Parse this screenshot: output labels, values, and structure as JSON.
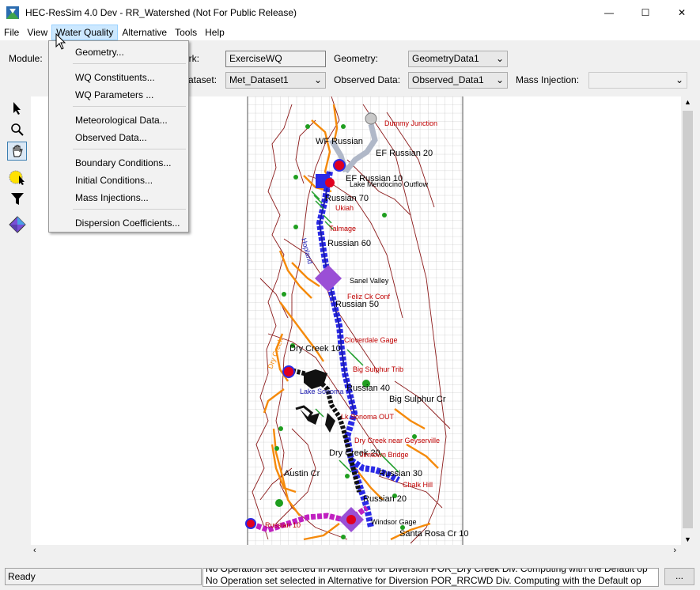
{
  "window": {
    "title": "HEC-ResSim 4.0 Dev  - RR_Watershed (Not For Public Release)",
    "minimize": "—",
    "maximize": "☐",
    "close": "✕"
  },
  "menu": {
    "items": [
      "File",
      "View",
      "Water Quality",
      "Alternative",
      "Tools",
      "Help"
    ],
    "active": "Water Quality"
  },
  "dropdown": {
    "groups": [
      [
        "Geometry..."
      ],
      [
        "WQ Constituents...",
        "WQ Parameters ..."
      ],
      [
        "Meteorological Data...",
        "Observed Data..."
      ],
      [
        "Boundary Conditions...",
        "Initial Conditions...",
        "Mass Injections..."
      ],
      [
        "Dispersion Coefficients..."
      ]
    ]
  },
  "fields": {
    "module_label": "Module:",
    "network_label": "ork:",
    "network_value": "ExerciseWQ",
    "geometry_label": "Geometry:",
    "geometry_value": "GeometryData1",
    "dataset_label": "ataset:",
    "dataset_value": "Met_Dataset1",
    "observed_label": "Observed Data:",
    "observed_value": "Observed_Data1",
    "mass_label": "Mass Injection:",
    "mass_value": ""
  },
  "map_labels": {
    "dummy_junction": "Dummy Junction",
    "wf_russian": "WF Russian",
    "ef_russian_20": "EF Russian 20",
    "ef_russian_10": "EF Russian 10",
    "lake_mendocino_outflow": "Lake Mendocino Outflow",
    "russian_70": "Russian 70",
    "ukiah": "Ukiah",
    "talmage": "Talmage",
    "russian_60": "Russian 60",
    "hopland": "Hopland",
    "sanel_valley": "Sanel Valley",
    "feliz_ck_conf": "Feliz Ck Conf",
    "russian_50": "Russian 50",
    "dry_creek_10": "Dry Creek 10",
    "cloverdale_gage": "Cloverdale Gage",
    "big_sulphur_trib": "Big Sulphur Trib",
    "russian_40": "Russian 40",
    "lake_sonoma": "Lake Sonoma",
    "big_sulphur_cr": "Big Sulphur Cr",
    "lk_sonoma_out": "Lk Sonoma OUT",
    "dry_creek_near_geyserville": "Dry Creek near Geyserville",
    "dry_creek_20": "Dry Creek 20",
    "jimtown_bridge": "Jimtown Bridge",
    "austin_cr": "Austin Cr",
    "russian_30": "Russian 30",
    "chalk_hill": "Chalk Hill",
    "russian_20": "Russian 20",
    "windsor_gage": "Windsor Gage",
    "santa_rosa_cr_10": "Santa Rosa Cr 10",
    "russian_10": "Russian 10",
    "dry_creek_label": "Dry Creek"
  },
  "status": {
    "ready": "Ready",
    "msg1": "No Operation set selected in Alternative for Diversion POR_Dry Creek Div. Computing with the Default op",
    "msg2": "No Operation set selected in Alternative for Diversion POR_RRCWD Div. Computing with the Default op",
    "more_button": "..."
  },
  "colors": {
    "river_blue": "#2a2ae6",
    "reach_orange": "#f58a0b",
    "basin_red": "#8b1a1a",
    "label_red": "#c00000",
    "magenta": "#c020c0",
    "junction_purple": "#9a4fd6"
  }
}
